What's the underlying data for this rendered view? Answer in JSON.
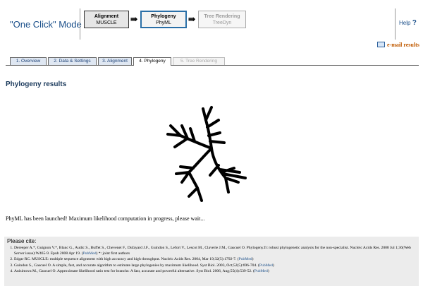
{
  "header": {
    "mode_title": "\"One Click\" Mode",
    "steps": [
      {
        "name": "Alignment",
        "tool": "MUSCLE"
      },
      {
        "name": "Phylogeny",
        "tool": "PhyML"
      },
      {
        "name": "Tree Rendering",
        "tool": "TreeDyn"
      }
    ],
    "arrow": "⇛",
    "help": "Help",
    "help_mark": "?"
  },
  "email": "e-mail results",
  "tabs": [
    "1. Overview",
    "2. Data & Settings",
    "3. Alignment",
    "4. Phylogeny",
    "5. Tree Rendering"
  ],
  "page_title": "Phylogeny results",
  "status": "PhyML has been launched! Maximum likelihood computation in progress, please wait...",
  "cite": {
    "title": "Please cite:",
    "refs": [
      {
        "text": "Dereeper A.*, Guignon V.*, Blanc G., Audic S., Buffet S., Chevenet F., Dufayard J.F., Guindon S., Lefort V., Lescot M., Claverie J.M., Gascuel O. Phylogeny.fr: robust phylogenetic analysis for the non-specialist. Nucleic Acids Res. 2008 Jul 1;36(Web Server issue):W465-9. Epub 2008 Apr 19. (",
        "link": "PubMed",
        "after": ") *: joint first authors"
      },
      {
        "text": "Edgar RC. MUSCLE: multiple sequence alignment with high accuracy and high throughput. Nucleic Acids Res. 2004, Mar 19;32(5):1792-7. (",
        "link": "PubMed",
        "after": ")"
      },
      {
        "text": "Guindon S., Gascuel O. A simple, fast, and accurate algorithm to estimate large phylogenies by maximum likelihood. Syst Biol. 2003, Oct;52(5):696-704. (",
        "link": "PubMed",
        "after": ")"
      },
      {
        "text": "Anisimova M., Gascuel O. Approximate likelihood ratio test for branchs: A fast, accurate and powerful alternative. Syst Biol. 2006, Aug;55(4):539-52. (",
        "link": "PubMed",
        "after": ")"
      }
    ]
  },
  "colors": {
    "accent": "#1a4f8a",
    "email": "#c05a00",
    "active_step": "#2a6fa7"
  },
  "icons": [
    "email-icon",
    "tree-logo"
  ]
}
